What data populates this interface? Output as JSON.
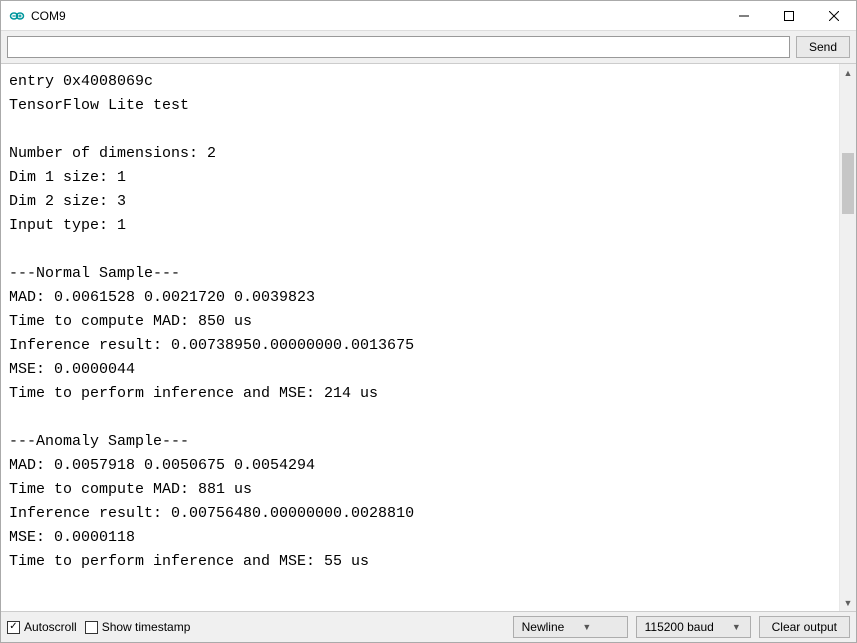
{
  "window": {
    "title": "COM9"
  },
  "toolbar": {
    "send_label": "Send",
    "input_value": ""
  },
  "console": {
    "lines": [
      "entry 0x4008069c",
      "TensorFlow Lite test",
      "",
      "Number of dimensions: 2",
      "Dim 1 size: 1",
      "Dim 2 size: 3",
      "Input type: 1",
      "",
      "---Normal Sample---",
      "MAD: 0.0061528 0.0021720 0.0039823",
      "Time to compute MAD: 850 us",
      "Inference result: 0.00738950.00000000.0013675",
      "MSE: 0.0000044",
      "Time to perform inference and MSE: 214 us",
      "",
      "---Anomaly Sample---",
      "MAD: 0.0057918 0.0050675 0.0054294",
      "Time to compute MAD: 881 us",
      "Inference result: 0.00756480.00000000.0028810",
      "MSE: 0.0000118",
      "Time to perform inference and MSE: 55 us"
    ]
  },
  "bottom": {
    "autoscroll_label": "Autoscroll",
    "autoscroll_checked": true,
    "timestamp_label": "Show timestamp",
    "timestamp_checked": false,
    "line_ending": "Newline",
    "baud": "115200 baud",
    "clear_label": "Clear output"
  },
  "icons": {
    "app": "arduino-icon",
    "minimize": "minimize-icon",
    "maximize": "maximize-icon",
    "close": "close-icon"
  }
}
